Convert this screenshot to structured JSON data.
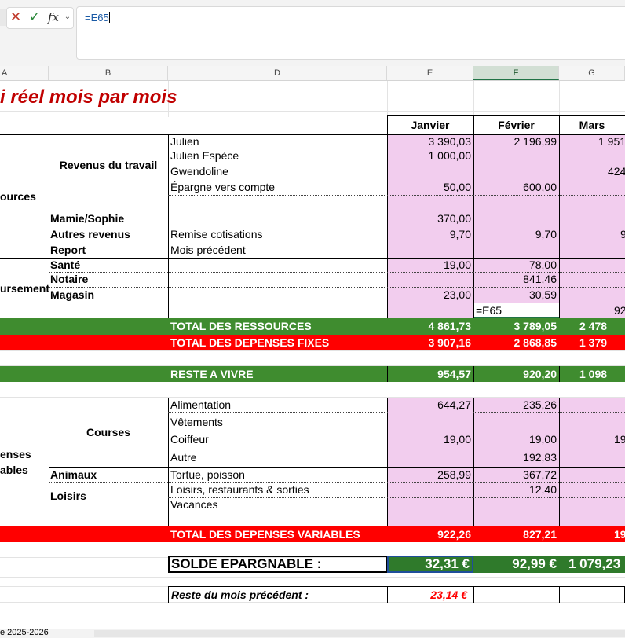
{
  "formula_bar": {
    "cancel_icon": "✕",
    "enter_icon": "✓",
    "fx_label": "fx",
    "formula": "=E65"
  },
  "columns": [
    "A",
    "B",
    "D",
    "E",
    "F",
    "G"
  ],
  "title": "i réel mois par mois",
  "months": [
    "Janvier",
    "Février",
    "Mars"
  ],
  "ressources": {
    "section_label": "ources",
    "revenus_label": "Revenus du travail",
    "mamie": "Mamie/Sophie",
    "autres": "Autres revenus",
    "report": "Report",
    "julien": "Julien",
    "julien_espece": "Julien Espèce",
    "gwendoline": "Gwendoline",
    "epargne": "Épargne vers compte",
    "remise": "Remise cotisations",
    "mois_prec": "Mois précédent",
    "julien_vals": [
      "3 390,03",
      "2 196,99",
      "1 951"
    ],
    "espece_vals": [
      "1 000,00"
    ],
    "gwen_vals": [
      "424"
    ],
    "epargne_vals": [
      "50,00",
      "600,00"
    ],
    "mamie_vals": [
      "370,00"
    ],
    "remise_vals": [
      "9,70",
      "9,70",
      "9"
    ]
  },
  "remb": {
    "section_label": "ursement",
    "sante": "Santé",
    "notaire": "Notaire",
    "magasin": "Magasin",
    "sante_vals": [
      "19,00",
      "78,00"
    ],
    "notaire_vals": [
      "841,46"
    ],
    "magasin_vals": [
      "23,00",
      "30,59"
    ],
    "edit_cell": "=E65",
    "g_extra": "92"
  },
  "totals": {
    "ressources_label": "TOTAL DES RESSOURCES",
    "ressources_vals": [
      "4 861,73",
      "3 789,05",
      "2 478"
    ],
    "fixes_label": "TOTAL DES DEPENSES FIXES",
    "fixes_vals": [
      "3 907,16",
      "2 868,85",
      "1 379"
    ],
    "reste_label": "RESTE A VIVRE",
    "reste_vals": [
      "954,57",
      "920,20",
      "1 098"
    ]
  },
  "variables": {
    "section_label_1": "enses",
    "section_label_2": "ables",
    "courses": "Courses",
    "animaux": "Animaux",
    "loisirs": "Loisirs",
    "alimentation": "Alimentation",
    "vetements": "Vêtements",
    "coiffeur": "Coiffeur",
    "autre": "Autre",
    "tortue": "Tortue, poisson",
    "restaurants": "Loisirs, restaurants & sorties",
    "vacances": "Vacances",
    "alim_vals": [
      "644,27",
      "235,26"
    ],
    "coiffeur_vals": [
      "19,00",
      "19,00",
      "19"
    ],
    "autre_vals": [
      "192,83"
    ],
    "tortue_vals": [
      "258,99",
      "367,72"
    ],
    "resto_vals": [
      "12,40"
    ],
    "total_label": "TOTAL DES DEPENSES VARIABLES",
    "total_vals": [
      "922,26",
      "827,21",
      "19"
    ]
  },
  "solde": {
    "label": "SOLDE EPARGNABLE :",
    "vals": [
      "32,31 €",
      "92,99 €",
      "1 079,23"
    ]
  },
  "reste_prec": {
    "label": "Reste du mois précédent :",
    "val": "23,14 €"
  },
  "sheet_tab": "e 2025-2026",
  "colors": {
    "pink": "#f2cdee",
    "green": "#3f8c2f",
    "red": "#ff0000",
    "title": "#c00000"
  }
}
